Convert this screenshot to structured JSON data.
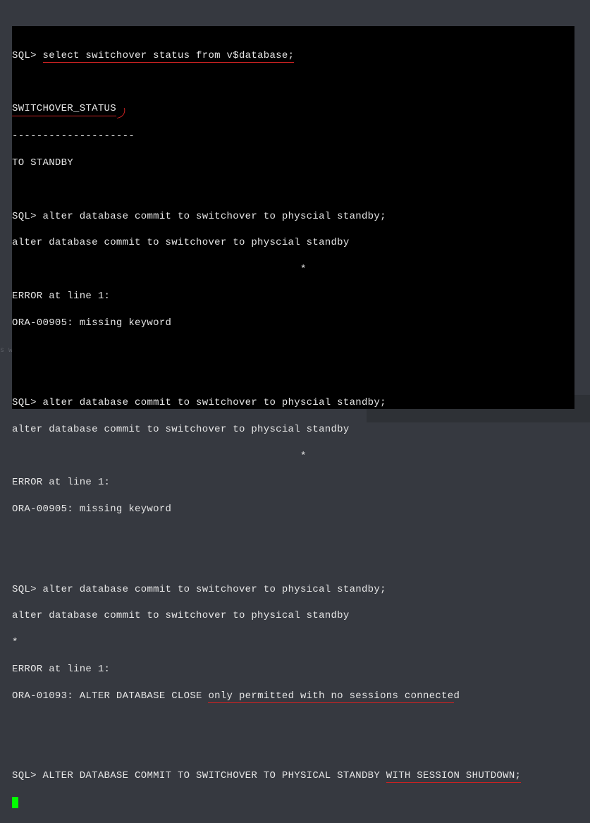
{
  "watermark": "s w",
  "prompt": "SQL>",
  "cmd1": "select switchover status from v$database;",
  "col_header": "SWITCHOVER_STATUS",
  "col_divider": "--------------------",
  "col_value": "TO STANDBY",
  "cmd2": "alter database commit to switchover to physcial standby;",
  "echo2": "alter database commit to switchover to physcial standby",
  "asterisk_indent": "                                               *",
  "err_line1": "ERROR at line 1:",
  "err_00905": "ORA-00905: missing keyword",
  "cmd3": "alter database commit to switchover to physcial standby;",
  "echo3": "alter database commit to switchover to physcial standby",
  "cmd4": "alter database commit to switchover to physical standby;",
  "echo4": "alter database commit to switchover to physical standby",
  "asterisk_left": "*",
  "err_01093_pre": "ORA-01093: ALTER DATABASE CLOSE ",
  "err_01093_mid": "only permitted with no sessions connecte",
  "err_01093_post": "d",
  "cmd5_pre": "ALTER DATABASE COMMIT TO SWITCHOVER TO PHYSICAL STANDBY ",
  "cmd5_mid": "WITH SESSION SHUTDOWN;"
}
